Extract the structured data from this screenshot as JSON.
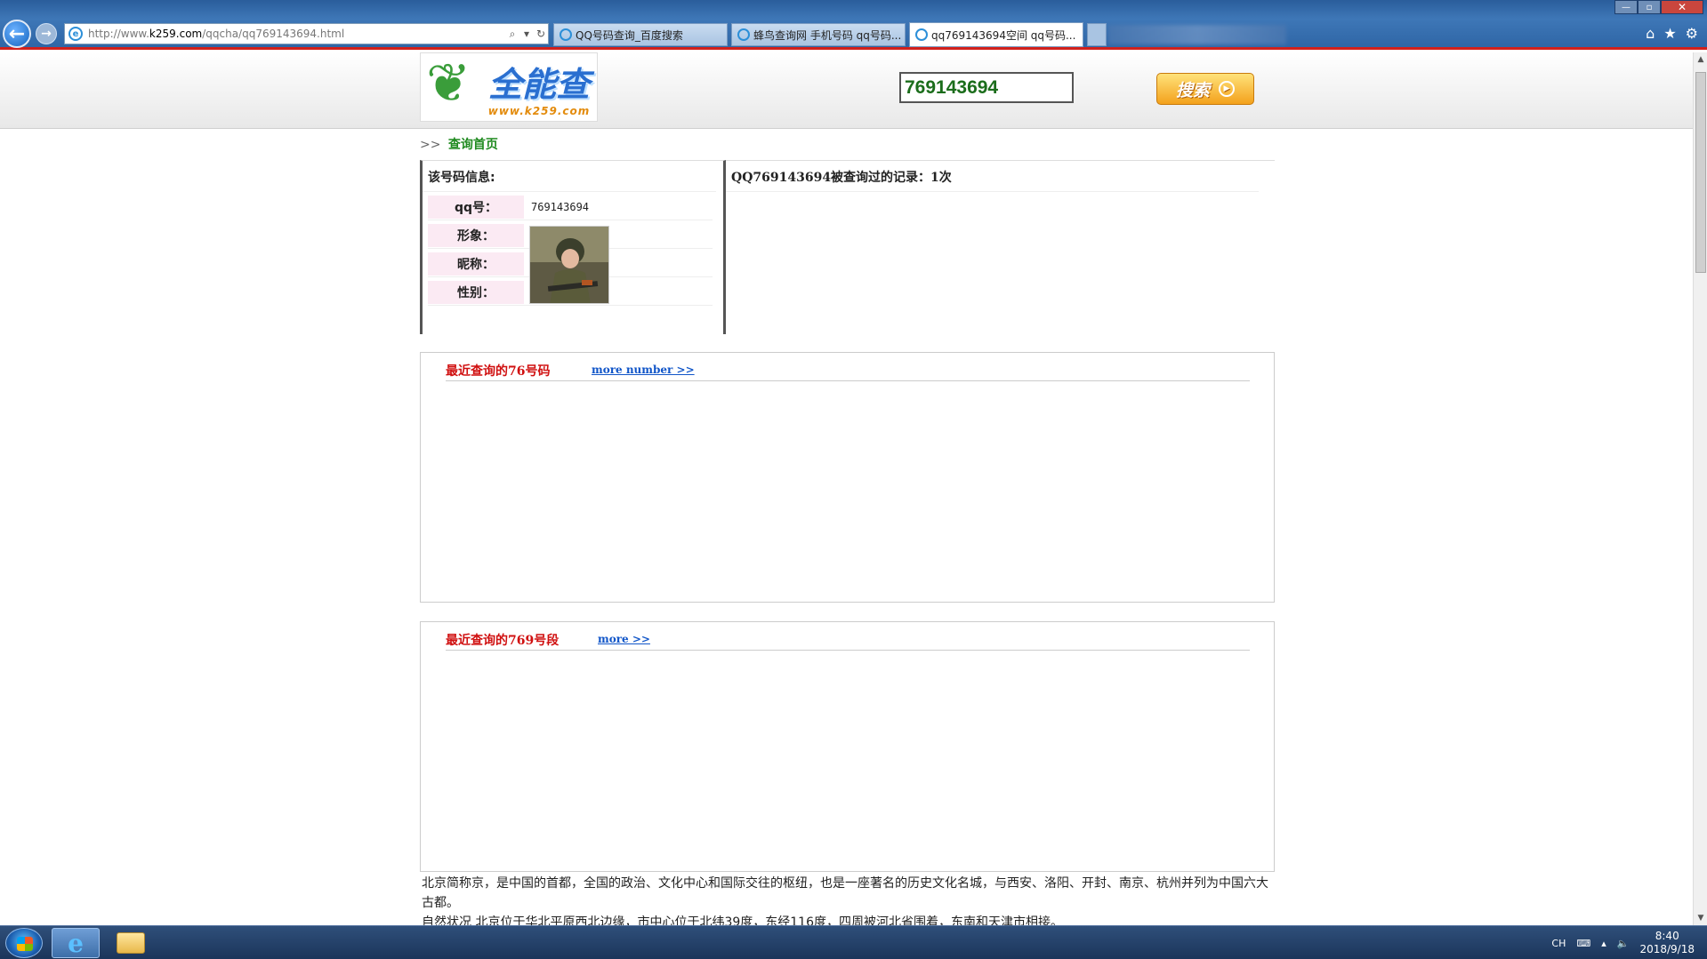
{
  "browser": {
    "url_prefix": "http://www.",
    "url_domain": "k259.com",
    "url_path": "/qqcha/qq769143694.html",
    "tabs": [
      {
        "label": "QQ号码查询_百度搜索"
      },
      {
        "label": "蜂鸟查询网 手机号码 qq号码..."
      },
      {
        "label": "qq769143694空间 qq号码...",
        "close": "×"
      }
    ]
  },
  "site": {
    "logo_text": "全能查",
    "logo_sub": "www.k259.com",
    "search_value": "769143694",
    "search_button": "搜索"
  },
  "breadcrumb": {
    "sep": ">>",
    "home": "查询首页"
  },
  "info": {
    "heading": "该号码信息:",
    "rows": [
      {
        "label": "qq号：",
        "value": "769143694"
      },
      {
        "label": "形象：",
        "value": ""
      },
      {
        "label": "昵称：",
        "value": ""
      },
      {
        "label": "性别：",
        "value": ""
      }
    ]
  },
  "history": {
    "heading": "QQ769143694被查询过的记录：1次"
  },
  "panels": [
    {
      "title": "最近查询的76号码",
      "more": "more number >>"
    },
    {
      "title": "最近查询的769号段",
      "more": "more >>"
    }
  ],
  "description": {
    "para1": "北京简称京，是中国的首都，全国的政治、文化中心和国际交往的枢纽，也是一座著名的历史文化名城，与西安、洛阳、开封、南京、杭州并列为中国六大古都。",
    "para2": "自然状况 北京位于华北平原西北边缘，市中心位于北纬39度，东经116度，四周被河北省围着，东南和天津市相接。"
  },
  "taskbar": {
    "lang": "CH",
    "time": "8:40",
    "date": "2018/9/18"
  }
}
